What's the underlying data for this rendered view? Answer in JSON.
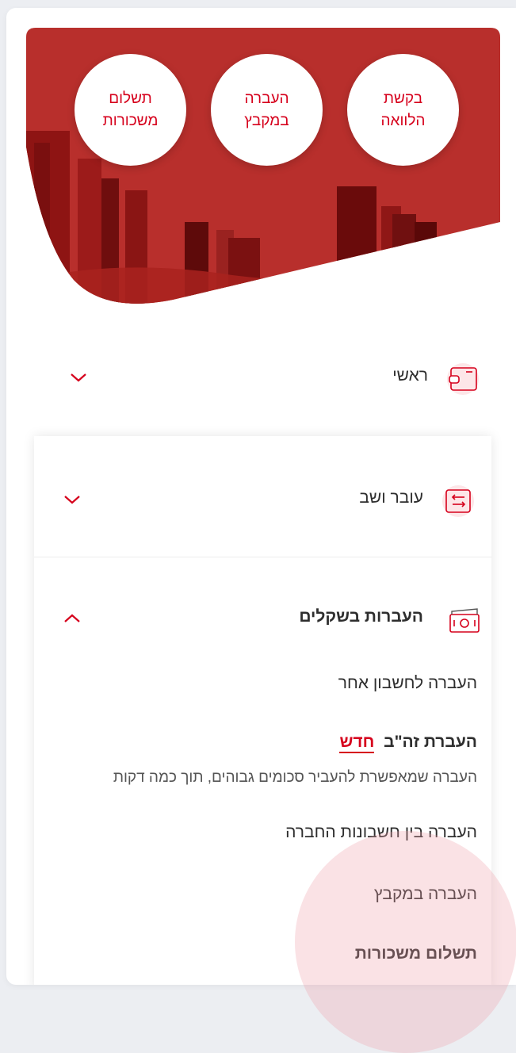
{
  "quick_actions": [
    {
      "label": "בקשת הלוואה"
    },
    {
      "label": "העברה במקבץ"
    },
    {
      "label": "תשלום משכורות"
    }
  ],
  "nav": {
    "home": {
      "label": "ראשי",
      "icon": "wallet-icon"
    },
    "current": {
      "label": "עובר ושב",
      "icon": "transfer-arrows-icon"
    },
    "transfers": {
      "label": "העברות בשקלים",
      "icon": "cash-icon"
    }
  },
  "submenu": {
    "other_account": "העברה לחשבון אחר",
    "rtgs_label": "העברת זה\"ב",
    "rtgs_new_tag": "חדש",
    "rtgs_desc": "העברה שמאפשרת להעביר סכומים גבוהים, תוך כמה דקות",
    "between_company": "העברה בין חשבונות החברה",
    "bulk_transfer": "העברה במקבץ",
    "salary_payment": "תשלום משכורות"
  },
  "colors": {
    "accent": "#d6001c",
    "hero_red": "#b52a28",
    "background": "#eceef2"
  }
}
